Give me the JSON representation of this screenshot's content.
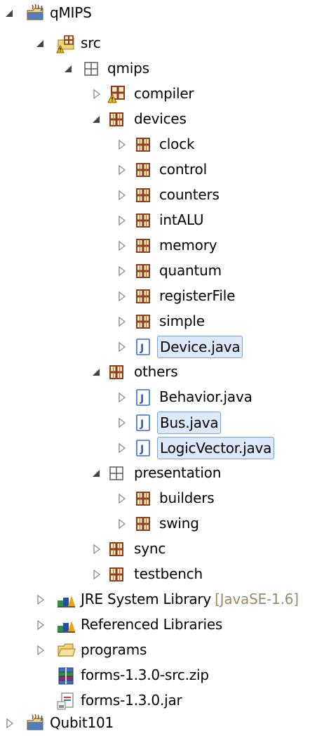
{
  "tree": {
    "items": [
      {
        "label": "qMIPS",
        "icon": "java-project-icon",
        "state": "expanded",
        "level": 0
      },
      {
        "label": "src",
        "icon": "source-folder-icon",
        "state": "expanded",
        "level": 1
      },
      {
        "label": "qmips",
        "icon": "empty-package-icon",
        "state": "expanded",
        "level": 2
      },
      {
        "label": "compiler",
        "icon": "package-warning-icon",
        "state": "collapsed",
        "level": 3
      },
      {
        "label": "devices",
        "icon": "package-icon",
        "state": "expanded",
        "level": 3
      },
      {
        "label": "clock",
        "icon": "package-icon",
        "state": "collapsed",
        "level": 4
      },
      {
        "label": "control",
        "icon": "package-icon",
        "state": "collapsed",
        "level": 4
      },
      {
        "label": "counters",
        "icon": "package-icon",
        "state": "collapsed",
        "level": 4
      },
      {
        "label": "intALU",
        "icon": "package-icon",
        "state": "collapsed",
        "level": 4
      },
      {
        "label": "memory",
        "icon": "package-icon",
        "state": "collapsed",
        "level": 4
      },
      {
        "label": "quantum",
        "icon": "package-icon",
        "state": "collapsed",
        "level": 4
      },
      {
        "label": "registerFile",
        "icon": "package-icon",
        "state": "collapsed",
        "level": 4
      },
      {
        "label": "simple",
        "icon": "package-icon",
        "state": "collapsed",
        "level": 4
      },
      {
        "label": "Device.java",
        "icon": "java-file-icon",
        "state": "collapsed",
        "level": 4,
        "selected": true
      },
      {
        "label": "others",
        "icon": "package-icon",
        "state": "expanded",
        "level": 3
      },
      {
        "label": "Behavior.java",
        "icon": "java-file-icon",
        "state": "collapsed",
        "level": 4
      },
      {
        "label": "Bus.java",
        "icon": "java-file-icon",
        "state": "collapsed",
        "level": 4,
        "selected": true
      },
      {
        "label": "LogicVector.java",
        "icon": "java-file-icon",
        "state": "collapsed",
        "level": 4,
        "selected": true
      },
      {
        "label": "presentation",
        "icon": "empty-package-icon",
        "state": "expanded",
        "level": 3
      },
      {
        "label": "builders",
        "icon": "package-icon",
        "state": "collapsed",
        "level": 4
      },
      {
        "label": "swing",
        "icon": "package-icon",
        "state": "collapsed",
        "level": 4
      },
      {
        "label": "sync",
        "icon": "package-icon",
        "state": "collapsed",
        "level": 3
      },
      {
        "label": "testbench",
        "icon": "package-icon",
        "state": "collapsed",
        "level": 3
      },
      {
        "label": "JRE System Library",
        "decoration": "[JavaSE-1.6]",
        "icon": "library-icon",
        "state": "collapsed",
        "level": 1
      },
      {
        "label": "Referenced Libraries",
        "icon": "library-icon",
        "state": "collapsed",
        "level": 1
      },
      {
        "label": "programs",
        "icon": "folder-icon",
        "state": "collapsed",
        "level": 1
      },
      {
        "label": "forms-1.3.0-src.zip",
        "icon": "zip-archive-icon",
        "state": "none",
        "level": 1
      },
      {
        "label": "forms-1.3.0.jar",
        "icon": "jar-file-icon",
        "state": "none",
        "level": 1
      },
      {
        "label": "Qubit101",
        "icon": "java-project-icon",
        "state": "collapsed",
        "level": 0
      }
    ]
  },
  "colors": {
    "selection_bg": "#dbe9fb",
    "selection_border": "#7da2ce",
    "package_brown": "#8a3e1a",
    "decoration_text": "#948b6a"
  }
}
